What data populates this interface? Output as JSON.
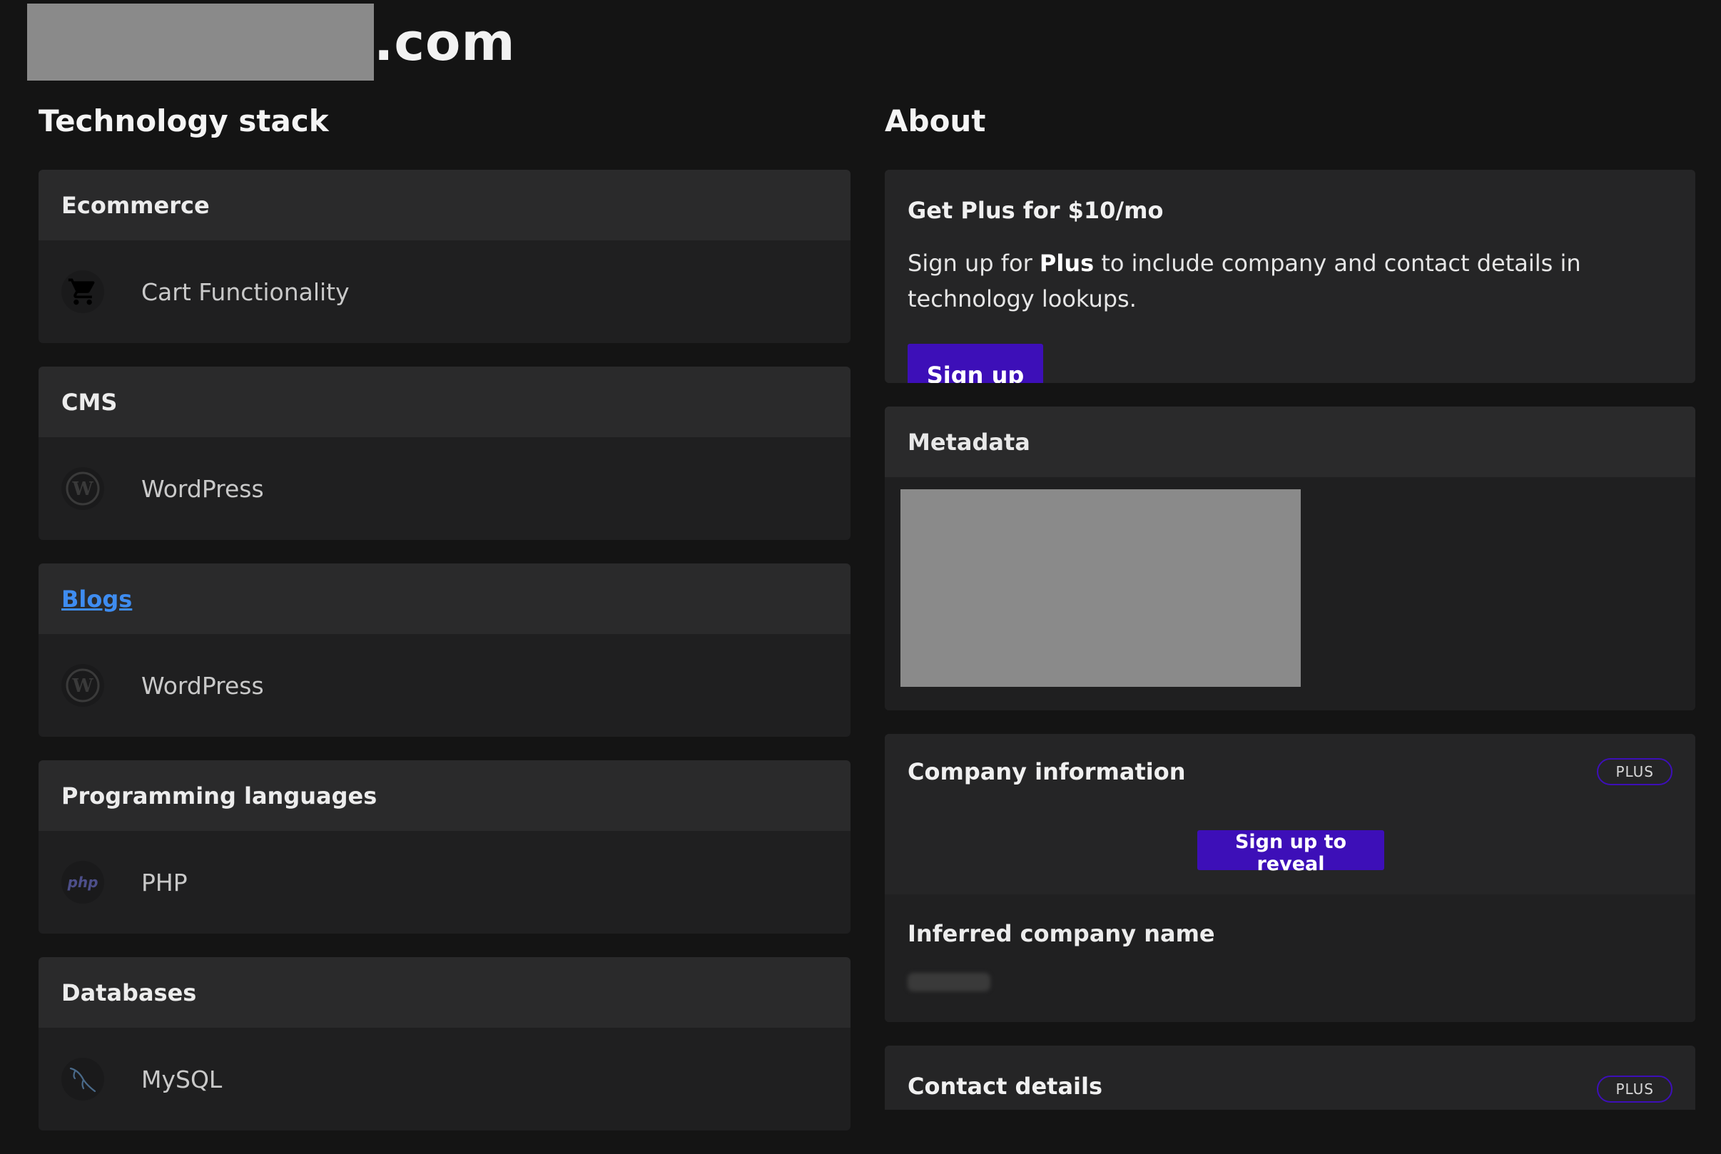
{
  "domain": {
    "suffix": ".com"
  },
  "left": {
    "title": "Technology stack",
    "categories": [
      {
        "name": "Ecommerce",
        "tech": "Cart Functionality",
        "icon": "cart-icon"
      },
      {
        "name": "CMS",
        "tech": "WordPress",
        "icon": "wordpress-icon"
      },
      {
        "name": "Blogs",
        "tech": "WordPress",
        "icon": "wordpress-icon",
        "link": true
      },
      {
        "name": "Programming languages",
        "tech": "PHP",
        "icon": "php-icon"
      },
      {
        "name": "Databases",
        "tech": "MySQL",
        "icon": "mysql-icon"
      }
    ]
  },
  "right": {
    "title": "About",
    "plus": {
      "title": "Get Plus for $10/mo",
      "text_before": "Sign up for ",
      "text_bold": "Plus",
      "text_after": " to include company and contact details in technology lookups.",
      "button": "Sign up"
    },
    "metadata": {
      "title": "Metadata"
    },
    "company": {
      "title": "Company information",
      "badge": "PLUS",
      "reveal_button": "Sign up to reveal",
      "inferred_label": "Inferred company name"
    },
    "contact": {
      "title": "Contact details",
      "badge": "PLUS"
    }
  },
  "colors": {
    "accent": "#3d0fb8",
    "link": "#3e8cf0",
    "background": "#141414"
  }
}
